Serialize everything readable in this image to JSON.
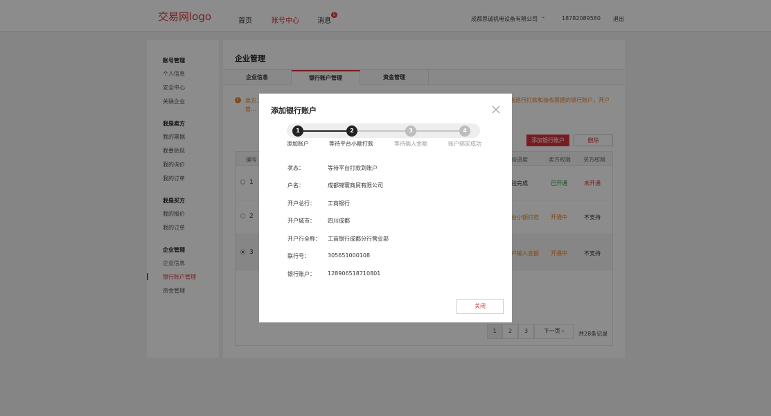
{
  "header": {
    "logo": "交易网logo",
    "nav": [
      "首页",
      "账号中心",
      "消息"
    ],
    "message_badge": "5",
    "company": "成都思诚机电设备有限公司",
    "phone": "18782089580",
    "logout": "退出"
  },
  "sidebar": {
    "groups": [
      {
        "title": "账号管理",
        "items": [
          "个人信息",
          "安全中心",
          "关联企业"
        ]
      },
      {
        "title": "我是卖方",
        "items": [
          "我的票据",
          "我要贴现",
          "我的询价",
          "我的订单"
        ]
      },
      {
        "title": "我是买方",
        "items": [
          "我的报价",
          "我的订单"
        ]
      },
      {
        "title": "企业管理",
        "items": [
          "企业信息",
          "银行账户管理",
          "资金管理"
        ]
      }
    ],
    "active_item": "银行账户管理"
  },
  "main": {
    "title": "企业管理",
    "tabs": [
      "企业信息",
      "银行账户管理",
      "资金管理"
    ],
    "notice_left": "卖方… 行管…",
    "notice_right": "会进行打款和接收票据的银行账户，开户",
    "add_button": "添加银行账户",
    "delete_button": "删除",
    "table": {
      "headers": [
        "编号",
        "验进度",
        "卖方权限",
        "买方权限"
      ],
      "rows": [
        {
          "no": "1",
          "progress": "验完成",
          "seller": "已开通",
          "buyer": "未开通"
        },
        {
          "no": "2",
          "progress": "台小额打款",
          "seller": "开通中",
          "buyer": "不支持"
        },
        {
          "no": "3",
          "progress": "户输入金额",
          "seller": "开通中",
          "buyer": "不支持"
        }
      ]
    },
    "pager": {
      "pages": [
        "1",
        "2",
        "3"
      ],
      "next": "下一页",
      "total": "共28条记录"
    }
  },
  "modal": {
    "title": "添加银行账户",
    "steps": [
      {
        "num": "1",
        "label": "添加账户"
      },
      {
        "num": "2",
        "label": "等待平台小额打款"
      },
      {
        "num": "3",
        "label": "等待输入金额"
      },
      {
        "num": "4",
        "label": "账户绑定成功"
      }
    ],
    "current_step": 2,
    "fields": [
      {
        "label": "状态：",
        "value": "等待平台打款到账户"
      },
      {
        "label": "户名：",
        "value": "成都锦寰商贸有限公司"
      },
      {
        "label": "开户总行：",
        "value": "工商银行"
      },
      {
        "label": "开户城市：",
        "value": "四川成都"
      },
      {
        "label": "开户行全称：",
        "value": "工商银行成都分行营业部"
      },
      {
        "label": "联行号：",
        "value": "305651000108"
      },
      {
        "label": "银行账户：",
        "value": "128906518710801"
      }
    ],
    "close_button": "关闭"
  },
  "colors": {
    "accent": "#d9363e",
    "warning": "#e8852a",
    "success": "#2e9a3a",
    "pending": "#e8852a"
  }
}
